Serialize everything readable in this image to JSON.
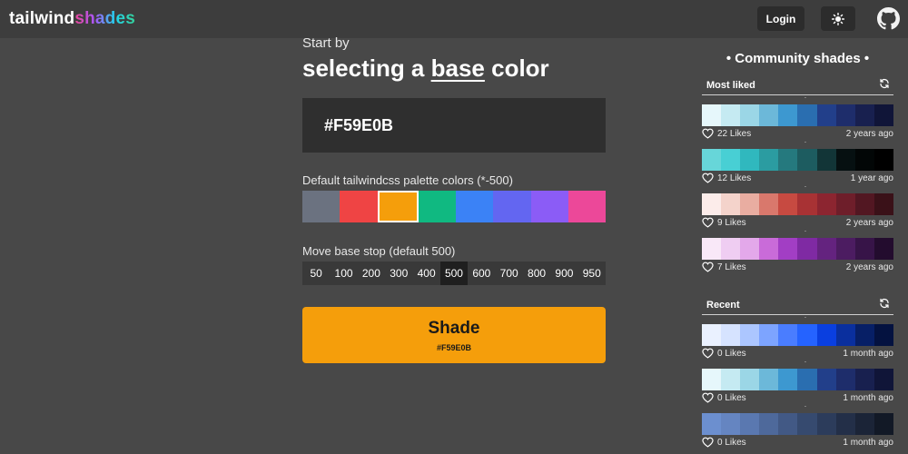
{
  "header": {
    "logo_part1": "tailwind",
    "logo_part2": "shades",
    "login_label": "Login",
    "theme_icon": "sun-icon",
    "github_icon": "github-icon"
  },
  "main": {
    "intro": "Start by",
    "headline_pre": "selecting a ",
    "headline_emph": "base",
    "headline_post": " color",
    "color_value": "#F59E0B",
    "palette_label": "Default tailwindcss palette colors (*-500)",
    "palette_colors": [
      "#6b7280",
      "#ef4444",
      "#f59e0b",
      "#10b981",
      "#3b82f6",
      "#6366f1",
      "#8b5cf6",
      "#ec4899"
    ],
    "selected_palette_index": 2,
    "stop_label": "Move base stop (default 500)",
    "stops": [
      "50",
      "100",
      "200",
      "300",
      "400",
      "500",
      "600",
      "700",
      "800",
      "900",
      "950"
    ],
    "active_stop": "500",
    "shade_button_label": "Shade",
    "shade_button_sub": "#F59E0B"
  },
  "sidebar": {
    "title": "• Community shades •",
    "most_liked_label": "Most liked",
    "recent_label": "Recent",
    "most_liked": [
      {
        "likes": "22 Likes",
        "ago": "2 years ago",
        "colors": [
          "#e6f7fb",
          "#c5eaf2",
          "#9bd6e6",
          "#6cb8d9",
          "#3d98d0",
          "#2a6eb0",
          "#223f8a",
          "#1e2d6b",
          "#18204f",
          "#101538"
        ]
      },
      {
        "likes": "12 Likes",
        "ago": "1 year ago",
        "colors": [
          "#67d6d9",
          "#48cfd4",
          "#30b8be",
          "#2b9ca1",
          "#25797e",
          "#1d5c60",
          "#123537",
          "#061011",
          "#020606",
          "#000000"
        ]
      },
      {
        "likes": "9 Likes",
        "ago": "2 years ago",
        "colors": [
          "#fcecea",
          "#f4d3cb",
          "#e9ada1",
          "#d9786c",
          "#c74a41",
          "#a83234",
          "#8c2530",
          "#6e1e2a",
          "#521722",
          "#3a1118"
        ]
      },
      {
        "likes": "7 Likes",
        "ago": "2 years ago",
        "colors": [
          "#f9e8f8",
          "#efcdf2",
          "#e3a8ea",
          "#c96bd9",
          "#a23ec4",
          "#7f2aa3",
          "#64237f",
          "#4c1c61",
          "#371448",
          "#230c2e"
        ]
      }
    ],
    "recent": [
      {
        "likes": "0 Likes",
        "ago": "1 month ago",
        "colors": [
          "#eaf1ff",
          "#d6e3ff",
          "#acc6ff",
          "#7da4ff",
          "#4a7dff",
          "#2563ff",
          "#0a3fe0",
          "#0a2f9e",
          "#071f66",
          "#041240"
        ]
      },
      {
        "likes": "0 Likes",
        "ago": "1 month ago",
        "colors": [
          "#e6f7fb",
          "#c5eaf2",
          "#9bd6e6",
          "#6cb8d9",
          "#3d98d0",
          "#2a6eb0",
          "#223f8a",
          "#1e2d6b",
          "#18204f",
          "#101538"
        ]
      },
      {
        "likes": "0 Likes",
        "ago": "1 month ago",
        "colors": [
          "#6c8fcf",
          "#6585c1",
          "#5a78b0",
          "#4e699b",
          "#425985",
          "#364a6f",
          "#2c3c5b",
          "#232f48",
          "#1b2437",
          "#121926"
        ]
      }
    ]
  }
}
